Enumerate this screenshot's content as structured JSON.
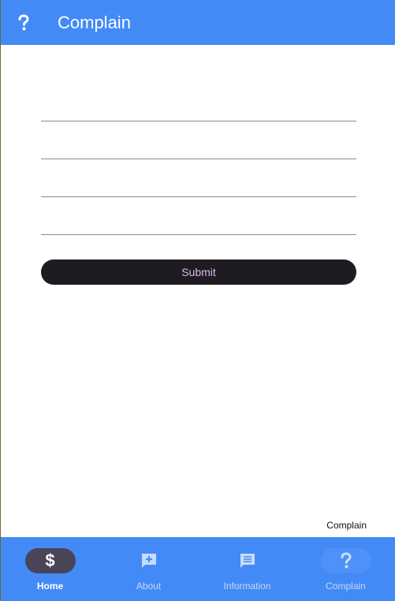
{
  "app_bar": {
    "title": "Complain",
    "icon": "help-icon"
  },
  "form": {
    "fields": [
      {
        "value": "",
        "placeholder": ""
      },
      {
        "value": "",
        "placeholder": ""
      },
      {
        "value": "",
        "placeholder": ""
      },
      {
        "value": "",
        "placeholder": ""
      }
    ],
    "submit_label": "Submit"
  },
  "page_label": "Complain",
  "bottom_nav": {
    "items": [
      {
        "label": "Home",
        "icon": "dollar-icon",
        "active": true
      },
      {
        "label": "About",
        "icon": "add-comment-icon",
        "active": false
      },
      {
        "label": "Information",
        "icon": "comment-icon",
        "active": false
      },
      {
        "label": "Complain",
        "icon": "help-icon",
        "active": false
      }
    ]
  },
  "colors": {
    "primary": "#448af7",
    "button_bg": "#1e1c21",
    "button_text": "#d9b8f5",
    "active_pill": "#4a4458"
  }
}
